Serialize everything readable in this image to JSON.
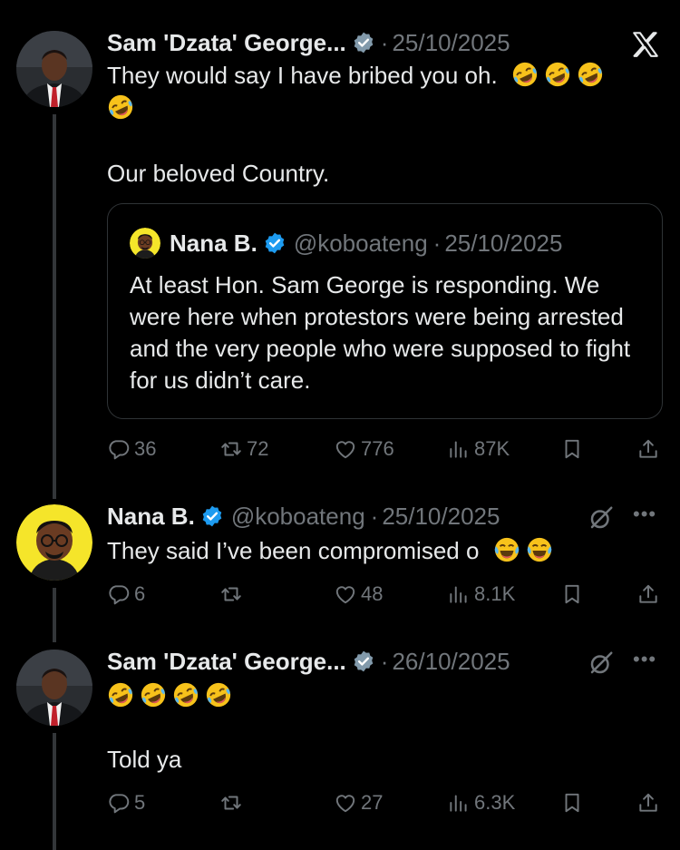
{
  "colors": {
    "background": "#000000",
    "text": "#e7e9ea",
    "muted": "#71767b",
    "verified": "#1d9bf0",
    "border": "#2f3336"
  },
  "tweets": [
    {
      "name": "Sam 'Dzata' George...",
      "badge": "verified-gray",
      "date": "25/10/2025",
      "text_line1": "They would say I have bribed you oh.",
      "emojis_line1": [
        "rolling-on-floor-laughing",
        "rolling-on-floor-laughing",
        "rolling-on-floor-laughing"
      ],
      "emojis_line2": [
        "rolling-on-floor-laughing"
      ],
      "text_line3": "Our beloved Country.",
      "corner_icon": "x-logo-icon",
      "quote": {
        "name": "Nana B.",
        "handle": "@koboateng",
        "date": "25/10/2025",
        "text": "At least Hon. Sam George is responding. We were here when protestors were being arrested and the very people who were supposed to fight for us didn’t care."
      },
      "stats": {
        "replies": "36",
        "reposts": "72",
        "likes": "776",
        "views": "87K"
      }
    },
    {
      "name": "Nana B.",
      "badge": "verified-blue",
      "handle": "@koboateng",
      "date": "25/10/2025",
      "text": "They said I’ve been compromised o",
      "emojis": [
        "face-with-tears-of-joy",
        "face-with-tears-of-joy"
      ],
      "stats": {
        "replies": "6",
        "reposts": "",
        "likes": "48",
        "views": "8.1K"
      }
    },
    {
      "name": "Sam 'Dzata' George...",
      "badge": "verified-gray",
      "date": "26/10/2025",
      "emojis": [
        "rolling-on-floor-laughing",
        "rolling-on-floor-laughing",
        "rolling-on-floor-laughing",
        "rolling-on-floor-laughing"
      ],
      "text": "Told ya",
      "stats": {
        "replies": "5",
        "reposts": "",
        "likes": "27",
        "views": "6.3K"
      }
    }
  ]
}
